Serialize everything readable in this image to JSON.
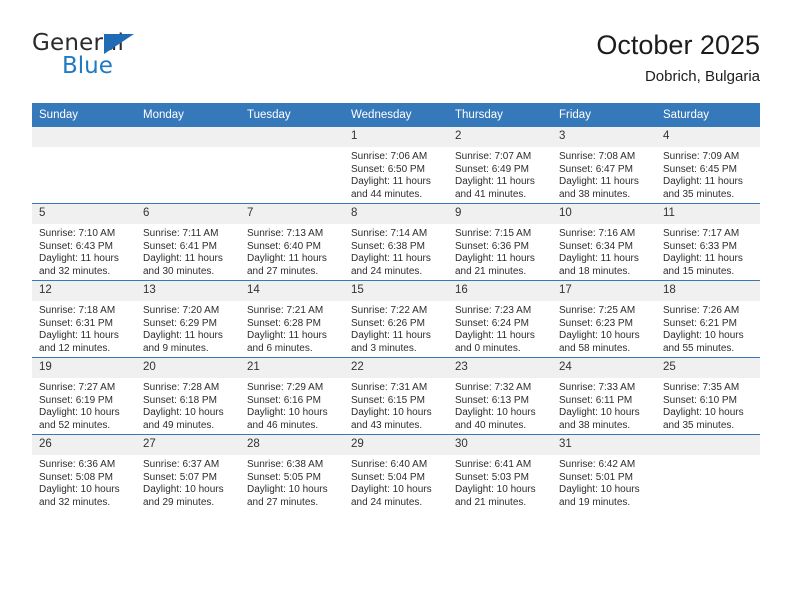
{
  "brand": {
    "name_top": "General",
    "name_bottom": "Blue",
    "accent_color": "#1f7ac4",
    "triangle_color": "#1f6cb4"
  },
  "header": {
    "title": "October 2025",
    "location": "Dobrich, Bulgaria"
  },
  "calendar": {
    "header_bg": "#3579bb",
    "header_text_color": "#ffffff",
    "daynum_bg": "#f0f0f0",
    "weekdays": [
      "Sunday",
      "Monday",
      "Tuesday",
      "Wednesday",
      "Thursday",
      "Friday",
      "Saturday"
    ],
    "labels": {
      "sunrise": "Sunrise:",
      "sunset": "Sunset:",
      "daylight": "Daylight:"
    },
    "weeks": [
      [
        {
          "day": "",
          "empty": true
        },
        {
          "day": "",
          "empty": true
        },
        {
          "day": "",
          "empty": true
        },
        {
          "day": "1",
          "sunrise": "Sunrise: 7:06 AM",
          "sunset": "Sunset: 6:50 PM",
          "daylight1": "Daylight: 11 hours",
          "daylight2": "and 44 minutes."
        },
        {
          "day": "2",
          "sunrise": "Sunrise: 7:07 AM",
          "sunset": "Sunset: 6:49 PM",
          "daylight1": "Daylight: 11 hours",
          "daylight2": "and 41 minutes."
        },
        {
          "day": "3",
          "sunrise": "Sunrise: 7:08 AM",
          "sunset": "Sunset: 6:47 PM",
          "daylight1": "Daylight: 11 hours",
          "daylight2": "and 38 minutes."
        },
        {
          "day": "4",
          "sunrise": "Sunrise: 7:09 AM",
          "sunset": "Sunset: 6:45 PM",
          "daylight1": "Daylight: 11 hours",
          "daylight2": "and 35 minutes."
        }
      ],
      [
        {
          "day": "5",
          "sunrise": "Sunrise: 7:10 AM",
          "sunset": "Sunset: 6:43 PM",
          "daylight1": "Daylight: 11 hours",
          "daylight2": "and 32 minutes."
        },
        {
          "day": "6",
          "sunrise": "Sunrise: 7:11 AM",
          "sunset": "Sunset: 6:41 PM",
          "daylight1": "Daylight: 11 hours",
          "daylight2": "and 30 minutes."
        },
        {
          "day": "7",
          "sunrise": "Sunrise: 7:13 AM",
          "sunset": "Sunset: 6:40 PM",
          "daylight1": "Daylight: 11 hours",
          "daylight2": "and 27 minutes."
        },
        {
          "day": "8",
          "sunrise": "Sunrise: 7:14 AM",
          "sunset": "Sunset: 6:38 PM",
          "daylight1": "Daylight: 11 hours",
          "daylight2": "and 24 minutes."
        },
        {
          "day": "9",
          "sunrise": "Sunrise: 7:15 AM",
          "sunset": "Sunset: 6:36 PM",
          "daylight1": "Daylight: 11 hours",
          "daylight2": "and 21 minutes."
        },
        {
          "day": "10",
          "sunrise": "Sunrise: 7:16 AM",
          "sunset": "Sunset: 6:34 PM",
          "daylight1": "Daylight: 11 hours",
          "daylight2": "and 18 minutes."
        },
        {
          "day": "11",
          "sunrise": "Sunrise: 7:17 AM",
          "sunset": "Sunset: 6:33 PM",
          "daylight1": "Daylight: 11 hours",
          "daylight2": "and 15 minutes."
        }
      ],
      [
        {
          "day": "12",
          "sunrise": "Sunrise: 7:18 AM",
          "sunset": "Sunset: 6:31 PM",
          "daylight1": "Daylight: 11 hours",
          "daylight2": "and 12 minutes."
        },
        {
          "day": "13",
          "sunrise": "Sunrise: 7:20 AM",
          "sunset": "Sunset: 6:29 PM",
          "daylight1": "Daylight: 11 hours",
          "daylight2": "and 9 minutes."
        },
        {
          "day": "14",
          "sunrise": "Sunrise: 7:21 AM",
          "sunset": "Sunset: 6:28 PM",
          "daylight1": "Daylight: 11 hours",
          "daylight2": "and 6 minutes."
        },
        {
          "day": "15",
          "sunrise": "Sunrise: 7:22 AM",
          "sunset": "Sunset: 6:26 PM",
          "daylight1": "Daylight: 11 hours",
          "daylight2": "and 3 minutes."
        },
        {
          "day": "16",
          "sunrise": "Sunrise: 7:23 AM",
          "sunset": "Sunset: 6:24 PM",
          "daylight1": "Daylight: 11 hours",
          "daylight2": "and 0 minutes."
        },
        {
          "day": "17",
          "sunrise": "Sunrise: 7:25 AM",
          "sunset": "Sunset: 6:23 PM",
          "daylight1": "Daylight: 10 hours",
          "daylight2": "and 58 minutes."
        },
        {
          "day": "18",
          "sunrise": "Sunrise: 7:26 AM",
          "sunset": "Sunset: 6:21 PM",
          "daylight1": "Daylight: 10 hours",
          "daylight2": "and 55 minutes."
        }
      ],
      [
        {
          "day": "19",
          "sunrise": "Sunrise: 7:27 AM",
          "sunset": "Sunset: 6:19 PM",
          "daylight1": "Daylight: 10 hours",
          "daylight2": "and 52 minutes."
        },
        {
          "day": "20",
          "sunrise": "Sunrise: 7:28 AM",
          "sunset": "Sunset: 6:18 PM",
          "daylight1": "Daylight: 10 hours",
          "daylight2": "and 49 minutes."
        },
        {
          "day": "21",
          "sunrise": "Sunrise: 7:29 AM",
          "sunset": "Sunset: 6:16 PM",
          "daylight1": "Daylight: 10 hours",
          "daylight2": "and 46 minutes."
        },
        {
          "day": "22",
          "sunrise": "Sunrise: 7:31 AM",
          "sunset": "Sunset: 6:15 PM",
          "daylight1": "Daylight: 10 hours",
          "daylight2": "and 43 minutes."
        },
        {
          "day": "23",
          "sunrise": "Sunrise: 7:32 AM",
          "sunset": "Sunset: 6:13 PM",
          "daylight1": "Daylight: 10 hours",
          "daylight2": "and 40 minutes."
        },
        {
          "day": "24",
          "sunrise": "Sunrise: 7:33 AM",
          "sunset": "Sunset: 6:11 PM",
          "daylight1": "Daylight: 10 hours",
          "daylight2": "and 38 minutes."
        },
        {
          "day": "25",
          "sunrise": "Sunrise: 7:35 AM",
          "sunset": "Sunset: 6:10 PM",
          "daylight1": "Daylight: 10 hours",
          "daylight2": "and 35 minutes."
        }
      ],
      [
        {
          "day": "26",
          "sunrise": "Sunrise: 6:36 AM",
          "sunset": "Sunset: 5:08 PM",
          "daylight1": "Daylight: 10 hours",
          "daylight2": "and 32 minutes."
        },
        {
          "day": "27",
          "sunrise": "Sunrise: 6:37 AM",
          "sunset": "Sunset: 5:07 PM",
          "daylight1": "Daylight: 10 hours",
          "daylight2": "and 29 minutes."
        },
        {
          "day": "28",
          "sunrise": "Sunrise: 6:38 AM",
          "sunset": "Sunset: 5:05 PM",
          "daylight1": "Daylight: 10 hours",
          "daylight2": "and 27 minutes."
        },
        {
          "day": "29",
          "sunrise": "Sunrise: 6:40 AM",
          "sunset": "Sunset: 5:04 PM",
          "daylight1": "Daylight: 10 hours",
          "daylight2": "and 24 minutes."
        },
        {
          "day": "30",
          "sunrise": "Sunrise: 6:41 AM",
          "sunset": "Sunset: 5:03 PM",
          "daylight1": "Daylight: 10 hours",
          "daylight2": "and 21 minutes."
        },
        {
          "day": "31",
          "sunrise": "Sunrise: 6:42 AM",
          "sunset": "Sunset: 5:01 PM",
          "daylight1": "Daylight: 10 hours",
          "daylight2": "and 19 minutes."
        },
        {
          "day": "",
          "empty": true
        }
      ]
    ]
  }
}
